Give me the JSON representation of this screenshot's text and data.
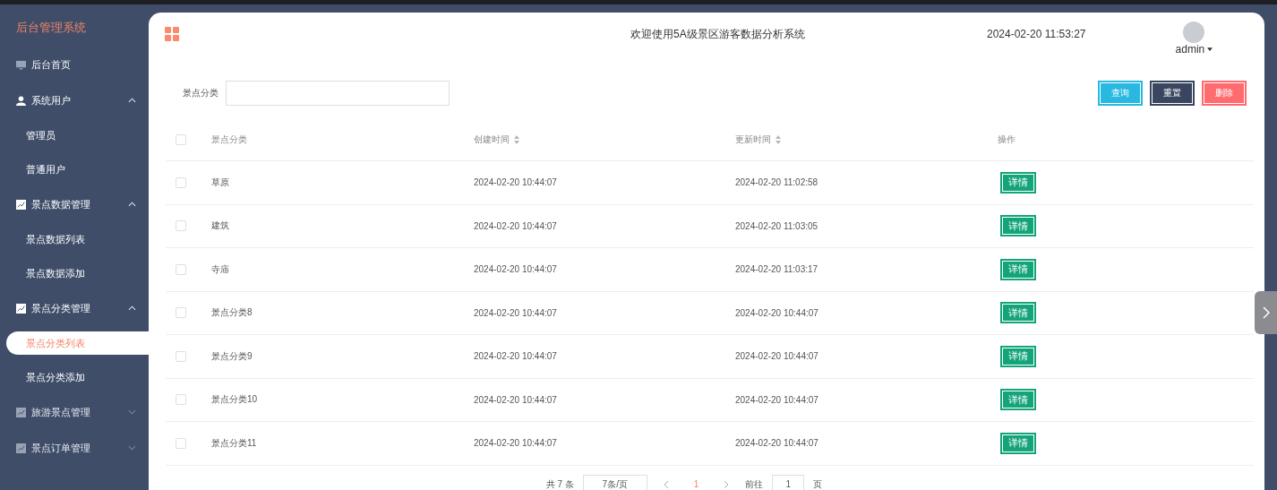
{
  "sidebar": {
    "title": "后台管理系统",
    "items": [
      {
        "label": "后台首页",
        "kind": "link"
      },
      {
        "label": "系统用户",
        "kind": "group",
        "expanded": true,
        "children": [
          {
            "label": "管理员",
            "selected": false
          },
          {
            "label": "普通用户",
            "selected": false
          }
        ]
      },
      {
        "label": "景点数据管理",
        "kind": "group",
        "expanded": true,
        "children": [
          {
            "label": "景点数据列表",
            "selected": false
          },
          {
            "label": "景点数据添加",
            "selected": false
          }
        ]
      },
      {
        "label": "景点分类管理",
        "kind": "group",
        "expanded": true,
        "children": [
          {
            "label": "景点分类列表",
            "selected": true
          },
          {
            "label": "景点分类添加",
            "selected": false
          }
        ]
      },
      {
        "label": "旅游景点管理",
        "kind": "group",
        "expanded": false
      },
      {
        "label": "景点订单管理",
        "kind": "group",
        "expanded": false
      }
    ]
  },
  "header": {
    "title": "欢迎使用5A级景区游客数据分析系统",
    "datetime": "2024-02-20 11:53:27",
    "user": "admin"
  },
  "search": {
    "label": "景点分类",
    "buttons": [
      {
        "label": "查询",
        "kind": "query"
      },
      {
        "label": "重置",
        "kind": "reset"
      },
      {
        "label": "删除",
        "kind": "delete"
      }
    ]
  },
  "table": {
    "all_checked": false,
    "columns": [
      {
        "label": "景点分类",
        "sortable": false
      },
      {
        "label": "创建时间",
        "sortable": true
      },
      {
        "label": "更新时间",
        "sortable": true
      },
      {
        "label": "操作",
        "sortable": false
      }
    ],
    "rows": [
      {
        "category": "草原",
        "created": "2024-02-20 10:44:07",
        "updated": "2024-02-20 11:02:58",
        "action": "详情",
        "checked": false
      },
      {
        "category": "建筑",
        "created": "2024-02-20 10:44:07",
        "updated": "2024-02-20 11:03:05",
        "action": "详情",
        "checked": false
      },
      {
        "category": "寺庙",
        "created": "2024-02-20 10:44:07",
        "updated": "2024-02-20 11:03:17",
        "action": "详情",
        "checked": false
      },
      {
        "category": "景点分类8",
        "created": "2024-02-20 10:44:07",
        "updated": "2024-02-20 10:44:07",
        "action": "详情",
        "checked": false
      },
      {
        "category": "景点分类9",
        "created": "2024-02-20 10:44:07",
        "updated": "2024-02-20 10:44:07",
        "action": "详情",
        "checked": false
      },
      {
        "category": "景点分类10",
        "created": "2024-02-20 10:44:07",
        "updated": "2024-02-20 10:44:07",
        "action": "详情",
        "checked": false
      },
      {
        "category": "景点分类11",
        "created": "2024-02-20 10:44:07",
        "updated": "2024-02-20 10:44:07",
        "action": "详情",
        "checked": false
      }
    ]
  },
  "pagination": {
    "total": "共 7 条",
    "page_size": "7条/页",
    "pages": [
      {
        "label": "1",
        "selected": true
      }
    ],
    "goto_label": "前往",
    "goto_value": "1",
    "goto_suffix": "页"
  }
}
